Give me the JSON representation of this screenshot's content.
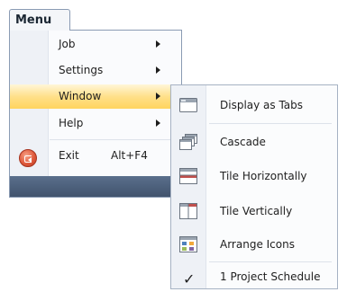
{
  "menu_tab": {
    "label": "Menu"
  },
  "main_menu": {
    "items": [
      {
        "label": "Job",
        "has_submenu": true
      },
      {
        "label": "Settings",
        "has_submenu": true
      },
      {
        "label": "Window",
        "has_submenu": true,
        "highlighted": true
      },
      {
        "label": "Help",
        "has_submenu": true
      }
    ],
    "exit": {
      "label": "Exit",
      "shortcut": "Alt+F4",
      "icon": "exit-icon"
    }
  },
  "window_submenu": {
    "items": [
      {
        "label": "Display as Tabs",
        "icon": "tabs-window-icon"
      },
      {
        "label": "Cascade",
        "icon": "cascade-icon"
      },
      {
        "label": "Tile Horizontally",
        "icon": "tile-horizontal-icon"
      },
      {
        "label": "Tile Vertically",
        "icon": "tile-vertical-icon"
      },
      {
        "label": "Arrange Icons",
        "icon": "arrange-icons-icon"
      }
    ],
    "open_windows": [
      {
        "label": "1 Project Schedule",
        "checked": true
      }
    ]
  },
  "colors": {
    "highlight": "#ffd45e",
    "footer": "#4a5d78",
    "border": "#8a9bb3"
  }
}
